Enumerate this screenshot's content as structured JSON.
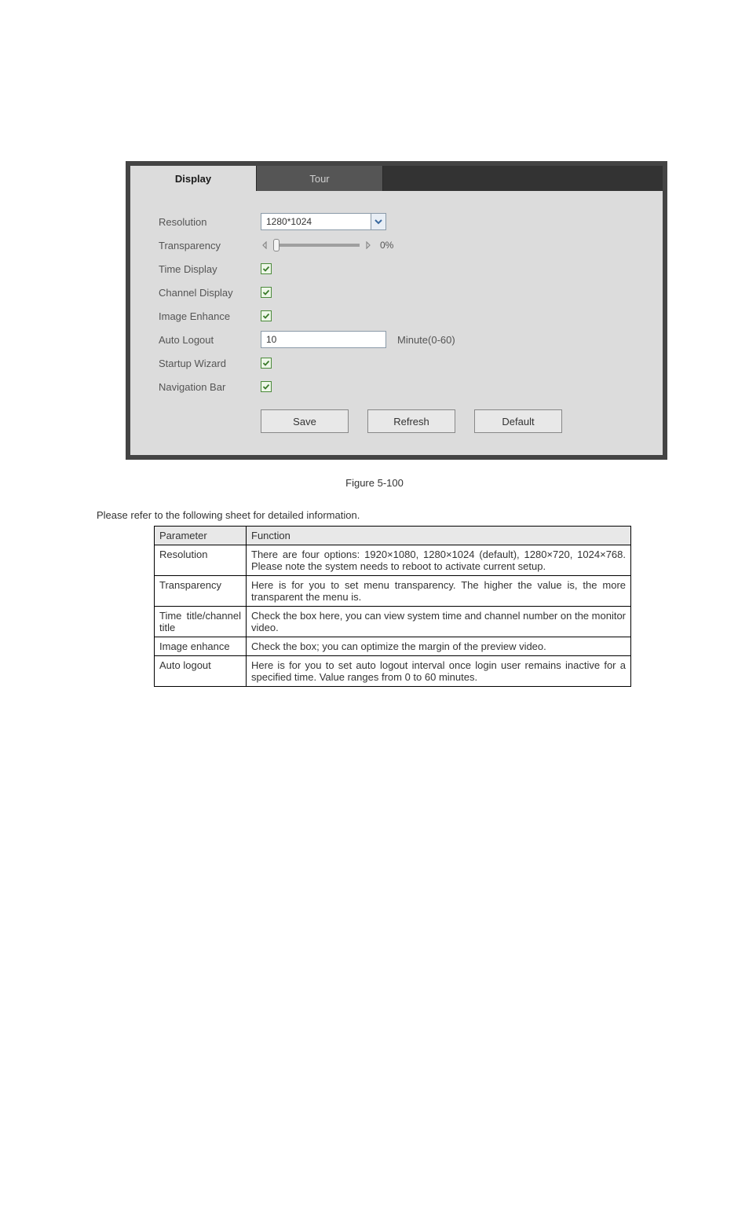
{
  "tabs": {
    "display": "Display",
    "tour": "Tour"
  },
  "labels": {
    "resolution": "Resolution",
    "transparency": "Transparency",
    "time_display": "Time Display",
    "channel_display": "Channel Display",
    "image_enhance": "Image Enhance",
    "auto_logout": "Auto Logout",
    "startup_wizard": "Startup Wizard",
    "navigation_bar": "Navigation Bar"
  },
  "values": {
    "resolution": "1280*1024",
    "transparency_readout": "0%",
    "auto_logout": "10",
    "auto_logout_suffix": "Minute(0-60)"
  },
  "buttons": {
    "save": "Save",
    "refresh": "Refresh",
    "default": "Default"
  },
  "caption": "Figure 5-100",
  "caption_sub": "Please refer to the following sheet for detailed information.",
  "table": {
    "head": {
      "param": "Parameter",
      "func": "Function"
    },
    "rows": [
      {
        "param": "Resolution",
        "func": "There are four options: 1920×1080, 1280×1024 (default), 1280×720, 1024×768. Please note the system needs to reboot to activate current setup."
      },
      {
        "param": "Transparency",
        "func": "Here is for you to set menu transparency. The higher the value is, the more transparent the menu is."
      },
      {
        "param": "Time title/channel title",
        "func": "Check the box here, you can view system time and channel number on the monitor video."
      },
      {
        "param": "Image enhance",
        "func": "Check the box; you can optimize the margin of the preview video."
      },
      {
        "param": "Auto logout",
        "func": "Here is for you to set auto logout interval once login user remains inactive for a specified time. Value ranges from 0 to 60 minutes."
      }
    ]
  }
}
